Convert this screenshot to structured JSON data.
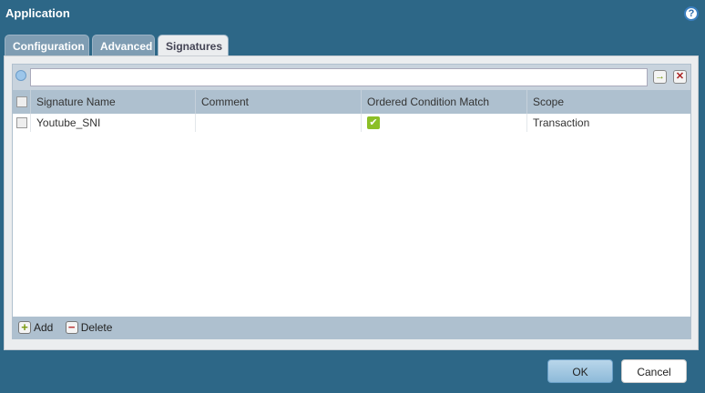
{
  "title": "Application",
  "tabs": [
    "Configuration",
    "Advanced",
    "Signatures"
  ],
  "search": {
    "value": "",
    "placeholder": ""
  },
  "columns": [
    "Signature Name",
    "Comment",
    "Ordered Condition Match",
    "Scope"
  ],
  "rows": [
    {
      "name": "Youtube_SNI",
      "comment": "",
      "ordered": true,
      "scope": "Transaction"
    }
  ],
  "toolbar": {
    "add": "Add",
    "delete": "Delete"
  },
  "buttons": {
    "ok": "OK",
    "cancel": "Cancel"
  }
}
